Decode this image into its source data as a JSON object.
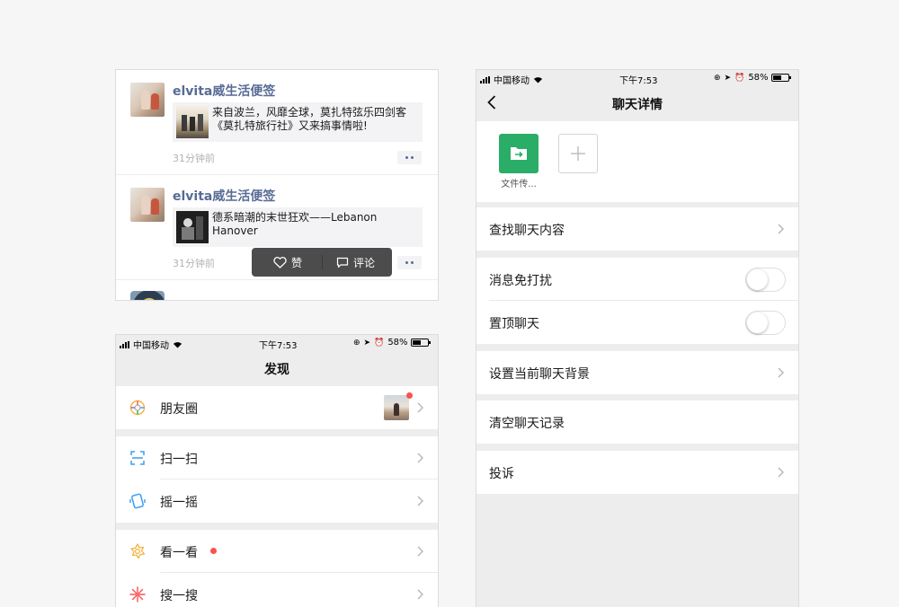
{
  "moments": {
    "posts": [
      {
        "author": "elvita威生活便签",
        "link_text": "来自波兰，风靡全球，莫扎特弦乐四剑客《莫扎特旅行社》又来搞事情啦!",
        "time": "31分钟前"
      },
      {
        "author": "elvita威生活便签",
        "link_text": "德系暗潮的末世狂欢——Lebanon Hanover",
        "time": "31分钟前"
      }
    ],
    "popup": {
      "like_label": "赞",
      "comment_label": "评论"
    }
  },
  "status_bar": {
    "carrier": "中国移动",
    "time": "下午7:53",
    "battery": "58%",
    "battery_level": 0.58
  },
  "discover": {
    "title": "发现",
    "items": [
      {
        "label": "朋友圈",
        "icon": "moments-icon"
      },
      {
        "label": "扫一扫",
        "icon": "scan-icon"
      },
      {
        "label": "摇一摇",
        "icon": "shake-icon"
      },
      {
        "label": "看一看",
        "icon": "top-stories-icon"
      },
      {
        "label": "搜一搜",
        "icon": "search-icon"
      }
    ]
  },
  "chat_details": {
    "title": "聊天详情",
    "member_name": "文件传...",
    "rows": [
      {
        "label": "查找聊天内容",
        "control": "chevron"
      },
      {
        "label": "消息免打扰",
        "control": "toggle",
        "value": false
      },
      {
        "label": "置顶聊天",
        "control": "toggle",
        "value": false
      },
      {
        "label": "设置当前聊天背景",
        "control": "chevron"
      },
      {
        "label": "清空聊天记录",
        "control": "none"
      },
      {
        "label": "投诉",
        "control": "chevron"
      }
    ]
  },
  "colors": {
    "link_blue": "#576b95",
    "wechat_green": "#2aae67",
    "badge_red": "#fa5151",
    "background_gray": "#ededed"
  }
}
